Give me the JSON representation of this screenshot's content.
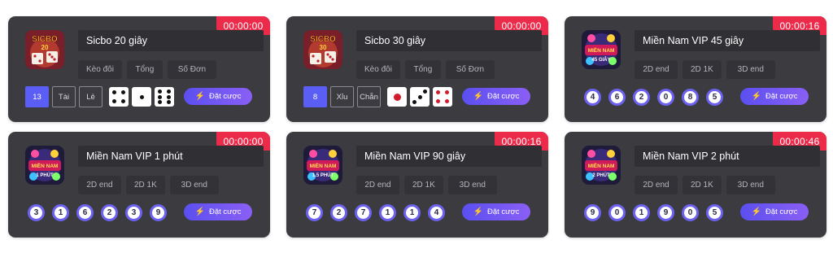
{
  "bet_label": "Đặt cược",
  "colors": {
    "card_bg": "#3b3b40",
    "timer_bg": "#ec2b4b",
    "accent": "#6d62f0",
    "button": "#5b4ff0"
  },
  "cards": [
    {
      "kind": "sicbo",
      "icon": "sicbo-game-icon",
      "icon_text": "SICBO 20",
      "title": "Sicbo 20 giây",
      "timer": "00:00:00",
      "tabs": [
        "Kèo đôi",
        "Tổng",
        "Số Đơn"
      ],
      "picks": [
        "13",
        "Tài",
        "Lẻ"
      ],
      "dice": [
        4,
        1,
        6
      ],
      "dice_style": "black"
    },
    {
      "kind": "sicbo",
      "icon": "sicbo-game-icon",
      "icon_text": "SICBO 30",
      "title": "Sicbo 30 giây",
      "timer": "00:00:00",
      "tabs": [
        "Kèo đôi",
        "Tổng",
        "Số Đơn"
      ],
      "picks": [
        "8",
        "Xỉu",
        "Chẵn"
      ],
      "dice": [
        1,
        3,
        4
      ],
      "dice_style": "red"
    },
    {
      "kind": "lottery",
      "icon": "mien-nam-vip-icon",
      "icon_text": "MIỀN NAM 45 GIÂY",
      "title": "Miền Nam VIP 45 giây",
      "timer": "00:00:16",
      "tabs": [
        "2D end",
        "2D 1K",
        "3D end"
      ],
      "balls": [
        "4",
        "6",
        "2",
        "0",
        "8",
        "5"
      ]
    },
    {
      "kind": "lottery",
      "icon": "mien-nam-vip-icon",
      "icon_text": "MIỀN NAM 1 PHÚT",
      "title": "Miền Nam VIP 1 phút",
      "timer": "00:00:00",
      "tabs": [
        "2D end",
        "2D 1K",
        "3D end"
      ],
      "balls": [
        "3",
        "1",
        "6",
        "2",
        "3",
        "9"
      ]
    },
    {
      "kind": "lottery",
      "icon": "mien-nam-vip-icon",
      "icon_text": "MIỀN NAM 1.5 PHÚT",
      "title": "Miền Nam VIP 90 giây",
      "timer": "00:00:16",
      "tabs": [
        "2D end",
        "2D 1K",
        "3D end"
      ],
      "balls": [
        "7",
        "2",
        "7",
        "1",
        "1",
        "4"
      ]
    },
    {
      "kind": "lottery",
      "icon": "mien-nam-vip-icon",
      "icon_text": "MIỀN NAM 2 PHÚT",
      "title": "Miền Nam VIP 2 phút",
      "timer": "00:00:46",
      "tabs": [
        "2D end",
        "2D 1K",
        "3D end"
      ],
      "balls": [
        "9",
        "0",
        "1",
        "9",
        "0",
        "5"
      ]
    }
  ]
}
